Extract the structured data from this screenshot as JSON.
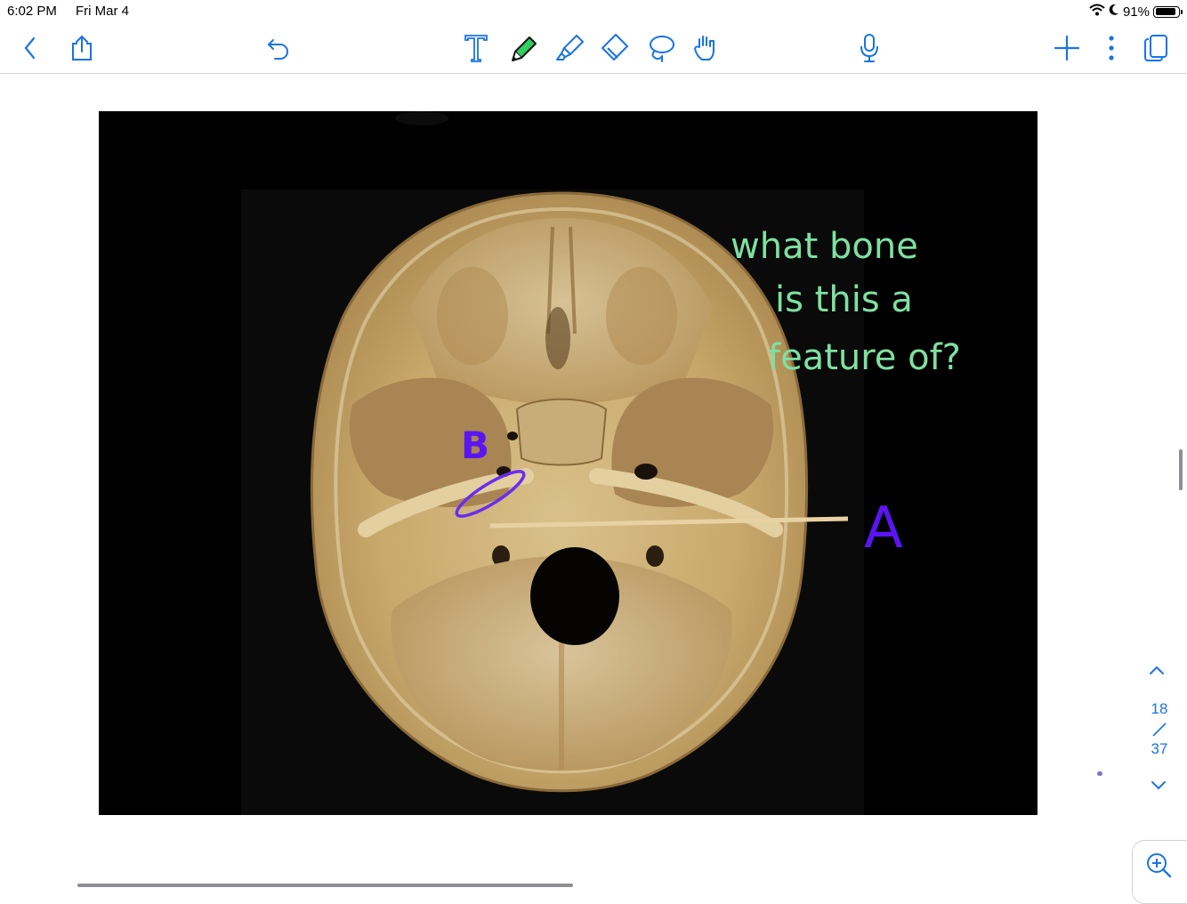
{
  "status_bar": {
    "time": "6:02 PM",
    "date": "Fri Mar 4",
    "battery_percent": "91%",
    "battery_level": 0.91
  },
  "toolbar": {
    "left": [
      {
        "name": "back-button",
        "icon": "chevron-left-icon"
      },
      {
        "name": "share-button",
        "icon": "share-icon"
      },
      {
        "name": "undo-button",
        "icon": "undo-icon"
      }
    ],
    "tools": [
      {
        "name": "text-tool",
        "icon": "text-t-icon"
      },
      {
        "name": "pen-tool",
        "icon": "pen-icon",
        "selected": true,
        "color": "#2fcf5f"
      },
      {
        "name": "highlighter-tool",
        "icon": "highlighter-icon"
      },
      {
        "name": "eraser-tool",
        "icon": "eraser-icon"
      },
      {
        "name": "lasso-tool",
        "icon": "lasso-icon"
      },
      {
        "name": "hand-tool",
        "icon": "hand-icon"
      }
    ],
    "right": [
      {
        "name": "mic-button",
        "icon": "microphone-icon"
      },
      {
        "name": "add-page-button",
        "icon": "plus-icon"
      },
      {
        "name": "more-button",
        "icon": "more-vertical-icon"
      },
      {
        "name": "pages-button",
        "icon": "pages-icon"
      }
    ],
    "accent_color": "#1a73e8"
  },
  "slide": {
    "annotation_lines": [
      "what bone",
      "is this a",
      "feature of?"
    ],
    "label_b": "B",
    "label_a": "A",
    "annotation_color": "#7ee0a2",
    "label_color": "#5b14f2"
  },
  "pagination": {
    "current": "18",
    "separator": "/",
    "total": "37"
  }
}
